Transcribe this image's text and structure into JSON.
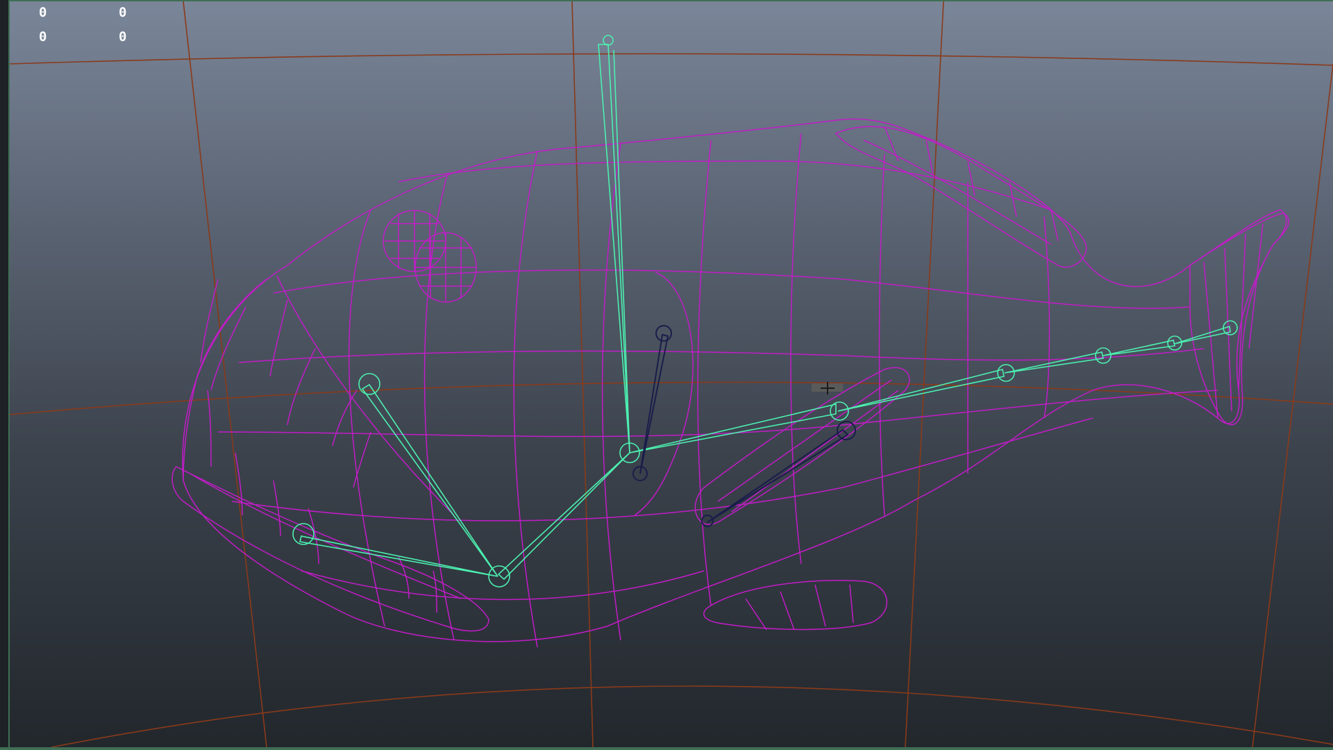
{
  "hud": {
    "rows": [
      [
        "0",
        "0"
      ],
      [
        "0",
        "0"
      ]
    ]
  },
  "colors": {
    "mesh_wireframe": "#c21cc8",
    "joint_selected": "#4cf0b0",
    "joint_unselected": "#1a1d4a",
    "grid_line": "#8a3a1a",
    "viewport_top": "#7a8699",
    "viewport_bottom": "#22272c",
    "hud_text": "#ffffff"
  },
  "icons": {
    "pivot": "move-pivot-icon"
  }
}
